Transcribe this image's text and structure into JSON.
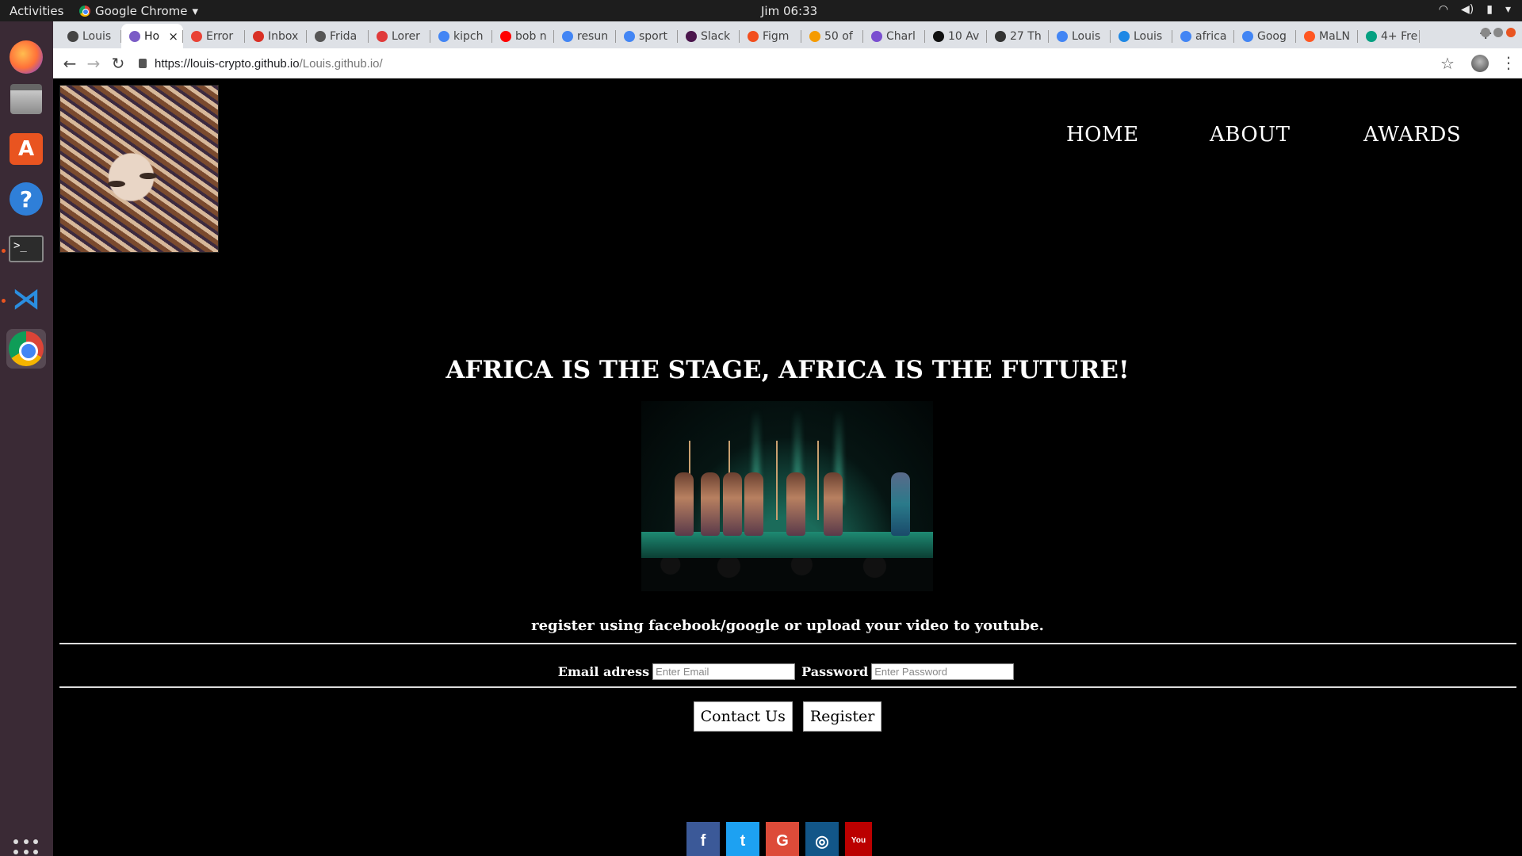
{
  "system": {
    "activities": "Activities",
    "app_name": "Google Chrome",
    "clock": "Jim 06:33"
  },
  "tabs": [
    {
      "label": "Louis",
      "color": "#444444"
    },
    {
      "label": "Ho",
      "color": "#7b5cc6",
      "active": true
    },
    {
      "label": "Error",
      "color": "#e94235"
    },
    {
      "label": "Inbox",
      "color": "#d93025"
    },
    {
      "label": "Frida",
      "color": "#555555"
    },
    {
      "label": "Lorer",
      "color": "#e03a3a"
    },
    {
      "label": "kipch",
      "color": "#4285f4"
    },
    {
      "label": "bob n",
      "color": "#ff0000"
    },
    {
      "label": "resun",
      "color": "#4285f4"
    },
    {
      "label": "sport",
      "color": "#4285f4"
    },
    {
      "label": "Slack",
      "color": "#4a154b"
    },
    {
      "label": "Figm",
      "color": "#f24e1e"
    },
    {
      "label": "50 of",
      "color": "#f59b00"
    },
    {
      "label": "Charl",
      "color": "#7a4fd0"
    },
    {
      "label": "10 Av",
      "color": "#111111"
    },
    {
      "label": "27 Th",
      "color": "#333333"
    },
    {
      "label": "Louis",
      "color": "#4285f4"
    },
    {
      "label": "Louis",
      "color": "#1e88e5"
    },
    {
      "label": "africa",
      "color": "#4285f4"
    },
    {
      "label": "Goog",
      "color": "#4285f4"
    },
    {
      "label": "MaLN",
      "color": "#ff5722"
    },
    {
      "label": "4+ Fre",
      "color": "#05a081"
    }
  ],
  "toolbar": {
    "url_host": "https://louis-crypto.github.io",
    "url_path": "/Louis.github.io/"
  },
  "page": {
    "nav": {
      "home": "HOME",
      "about": "ABOUT",
      "awards": "AWARDS"
    },
    "headline": "AFRICA IS THE STAGE, AFRICA IS THE FUTURE!",
    "register_text": "register using facebook/google or upload your video to youtube.",
    "form": {
      "email_label": "Email adress",
      "email_placeholder": "Enter Email",
      "password_label": "Password",
      "password_placeholder": "Enter Password"
    },
    "buttons": {
      "contact": "Contact Us",
      "register": "Register"
    },
    "social": [
      {
        "name": "facebook",
        "glyph": "f",
        "color": "#3b5998"
      },
      {
        "name": "twitter",
        "glyph": "t",
        "color": "#1da1f2"
      },
      {
        "name": "google",
        "glyph": "G",
        "color": "#dd4b39"
      },
      {
        "name": "instagram",
        "glyph": "◎",
        "color": "#125688"
      },
      {
        "name": "youtube",
        "glyph": "You",
        "color": "#bb0000"
      }
    ]
  }
}
